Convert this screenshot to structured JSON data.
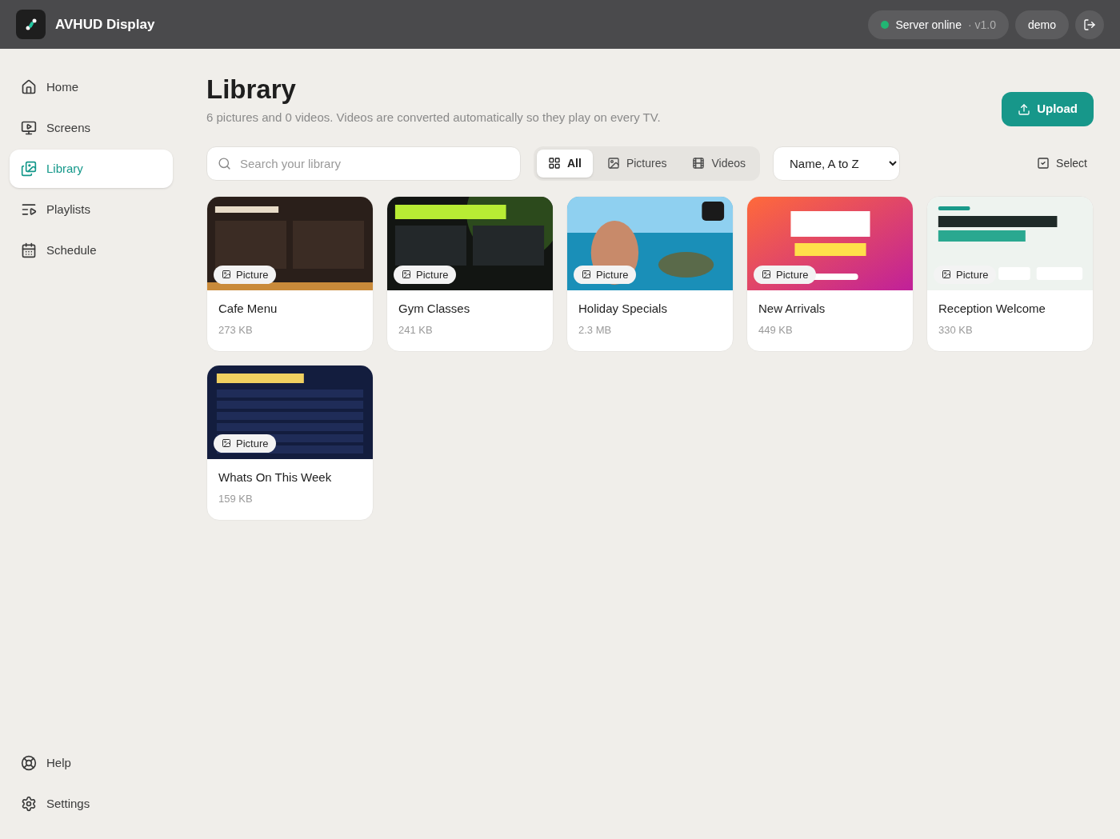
{
  "app": {
    "title": "AVHUD Display"
  },
  "header": {
    "status": "Server online",
    "version": "· v1.0",
    "user": "demo"
  },
  "sidebar": {
    "items": [
      {
        "label": "Home",
        "selected": false
      },
      {
        "label": "Screens",
        "selected": false
      },
      {
        "label": "Library",
        "selected": true
      },
      {
        "label": "Playlists",
        "selected": false
      },
      {
        "label": "Schedule",
        "selected": false
      }
    ],
    "footer": [
      {
        "label": "Help"
      },
      {
        "label": "Settings"
      }
    ]
  },
  "page": {
    "title": "Library",
    "subtitle": "6 pictures and 0 videos. Videos are converted automatically so they play on every TV.",
    "upload": "Upload"
  },
  "search": {
    "placeholder": "Search your library"
  },
  "filters": [
    {
      "label": "All",
      "selected": true
    },
    {
      "label": "Pictures",
      "selected": false
    },
    {
      "label": "Videos",
      "selected": false
    }
  ],
  "sort": "Name, A to Z",
  "select": "Select",
  "items": [
    {
      "name": "Cafe Menu",
      "size": "273 KB",
      "badge": "Picture",
      "kind": "picture"
    },
    {
      "name": "Gym Classes",
      "size": "241 KB",
      "badge": "Picture",
      "kind": "picture"
    },
    {
      "name": "Holiday Specials",
      "size": "2.3 MB",
      "badge": "Picture",
      "kind": "picture"
    },
    {
      "name": "New Arrivals",
      "size": "449 KB",
      "badge": "Picture",
      "kind": "picture"
    },
    {
      "name": "Reception Welcome",
      "size": "330 KB",
      "badge": "Picture",
      "kind": "picture"
    },
    {
      "name": "Whats On This Week",
      "size": "159 KB",
      "badge": "Picture",
      "kind": "picture"
    }
  ]
}
